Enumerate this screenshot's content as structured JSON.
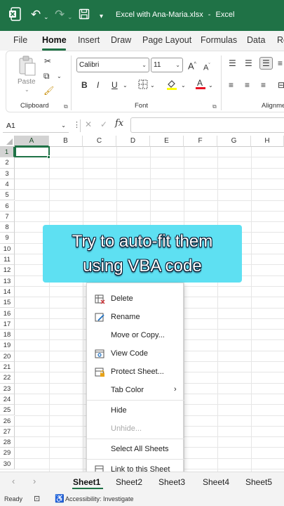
{
  "titlebar": {
    "file_name": "Excel with Ana-Maria.xlsx",
    "app_name": "Excel",
    "separator": "-"
  },
  "ribbon_tabs": [
    "File",
    "Home",
    "Insert",
    "Draw",
    "Page Layout",
    "Formulas",
    "Data",
    "Re"
  ],
  "ribbon": {
    "paste_label": "Paste",
    "clipboard_label": "Clipboard",
    "font_label": "Font",
    "alignment_label": "Alignme",
    "font_name": "Calibri",
    "font_size": "11"
  },
  "formula_bar": {
    "name_box": "A1",
    "fx": "fx",
    "cancel": "✕",
    "confirm": "✓",
    "more": "⋮"
  },
  "grid": {
    "columns": [
      "A",
      "B",
      "C",
      "D",
      "E",
      "F",
      "G",
      "H"
    ],
    "rows": [
      "1",
      "2",
      "3",
      "4",
      "5",
      "6",
      "7",
      "8",
      "9",
      "10",
      "11",
      "12",
      "13",
      "14",
      "15",
      "16",
      "17",
      "18",
      "19",
      "20",
      "21",
      "22",
      "23",
      "24",
      "25",
      "26",
      "27",
      "28",
      "29",
      "30"
    ]
  },
  "overlay": {
    "line1": "Try to auto-fit them",
    "line2": "using VBA code"
  },
  "context_menu": {
    "delete": "Delete",
    "rename": "Rename",
    "move_copy": "Move or Copy...",
    "view_code": "View Code",
    "protect_sheet": "Protect Sheet...",
    "tab_color": "Tab Color",
    "hide": "Hide",
    "unhide": "Unhide...",
    "select_all": "Select All Sheets",
    "link": "Link to this Sheet"
  },
  "sheet_tabs": [
    "Sheet1",
    "Sheet2",
    "Sheet3",
    "Sheet4",
    "Sheet5"
  ],
  "status": {
    "ready": "Ready",
    "accessibility": "Accessibility: Investigate"
  },
  "colors": {
    "excel_green": "#1f7246",
    "overlay": "#5ee0f2",
    "text_outline": "#071a30"
  }
}
